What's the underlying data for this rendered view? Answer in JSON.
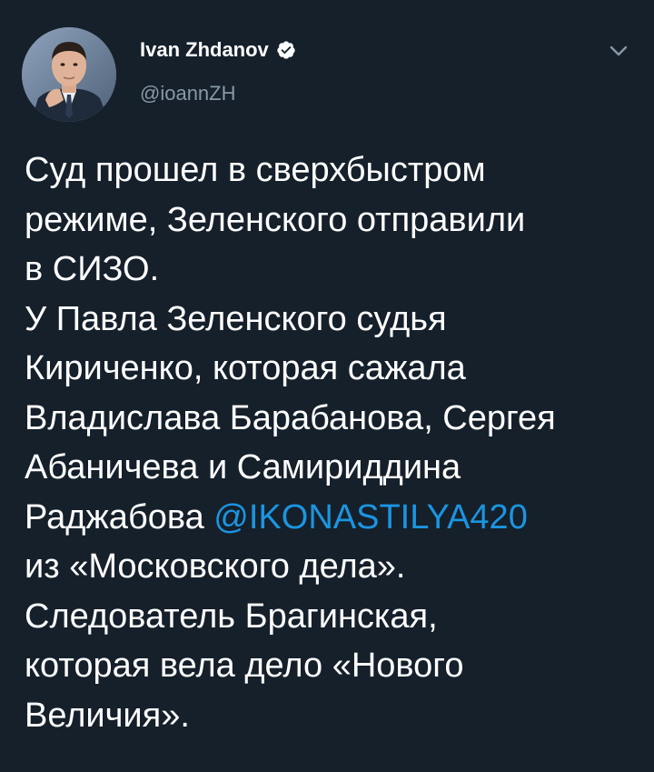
{
  "author": {
    "name": "Ivan Zhdanov",
    "handle": "@ioannZH",
    "verified": true,
    "avatar_icon": "profile-photo"
  },
  "header": {
    "caret_icon": "chevron-down-icon"
  },
  "tweet": {
    "lines": [
      "Суд прошел в сверхбыстром",
      "режиме, Зеленского отправили",
      "в СИЗО.",
      "У Павла Зеленского судья",
      "Кириченко, которая сажала",
      "Владислава Барабанова, Сергея",
      "Абаничева и Самириддина",
      "Раджабова ",
      "из «Московского дела».",
      "Следователь Брагинская,",
      "которая вела дело «Нового",
      "Величия»."
    ],
    "mention": "@IKONASTILYA420"
  },
  "colors": {
    "background": "#15202b",
    "text": "#ffffff",
    "secondary": "#8899a6",
    "link": "#1b95e0"
  }
}
